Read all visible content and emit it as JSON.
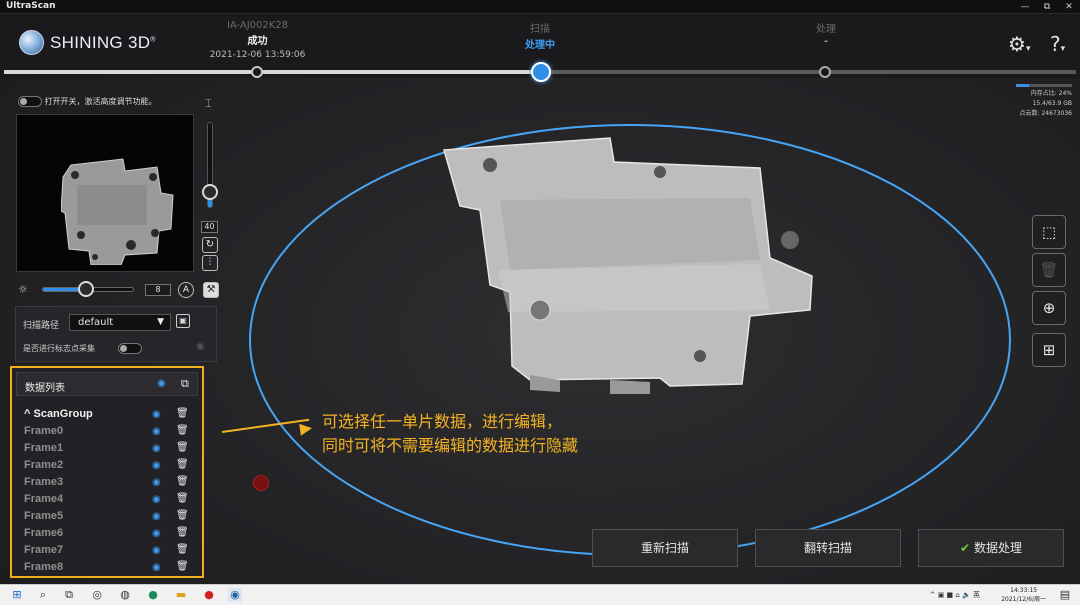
{
  "window": {
    "title": "UltraScan",
    "controls": [
      "—",
      "⧉",
      "✕"
    ]
  },
  "header": {
    "logo_text": "SHINING 3D",
    "logo_mark": "®",
    "steps": [
      {
        "name": "IA-AJ002K28",
        "status": "成功",
        "detail": "2021-12-06 13:59:06"
      },
      {
        "name": "扫描",
        "status": "处理中"
      },
      {
        "name": "处理",
        "status": "-"
      }
    ],
    "settings_icon": "gear-icon",
    "help_icon": "help-icon",
    "help_glyph": "?",
    "dropdown_glyph": "▾"
  },
  "memory": {
    "label": "内存占比: 24%",
    "size": "15.4/63.9 GB",
    "points": "点云数: 24673036",
    "fraction": 0.24
  },
  "camera_panel": {
    "toggle_label": "打开开关，激活高度调节功能。",
    "height_value": "40",
    "brightness_value": "8",
    "auto_label": "A"
  },
  "scan_panel": {
    "path_label": "扫描路径",
    "path_value": "default",
    "marker_label": "是否进行标志点采集"
  },
  "data_list": {
    "title": "数据列表",
    "group": "ScanGroup",
    "frames": [
      "Frame0",
      "Frame1",
      "Frame2",
      "Frame3",
      "Frame4",
      "Frame5",
      "Frame6",
      "Frame7",
      "Frame8"
    ]
  },
  "annotation": {
    "line1": "可选择任一单片数据，进行编辑，",
    "line2": "同时可将不需要编辑的数据进行隐藏"
  },
  "buttons": {
    "rescan": "重新扫描",
    "flip": "翻转扫描",
    "process": "数据处理",
    "process_icon": "✔"
  },
  "taskbar": {
    "time": "14:33:15",
    "date": "2021/12/6/周一",
    "tray": "^ ▣ ■ ⌂ 🔈 英"
  }
}
